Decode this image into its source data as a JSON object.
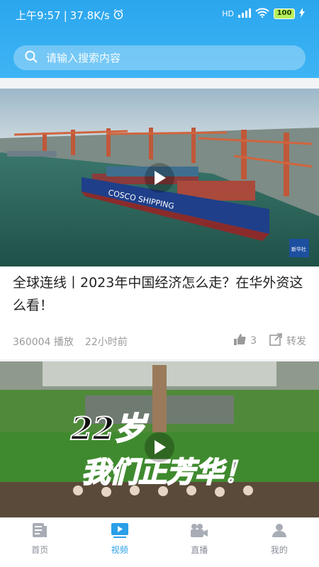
{
  "status_bar": {
    "time": "上午9:57",
    "speed": "37.8K/s",
    "network": "HD",
    "battery": "100"
  },
  "search": {
    "placeholder": "请输入搜索内容"
  },
  "feed": {
    "items": [
      {
        "title": "全球连线丨2023年中国经济怎么走？在华外资这么看！",
        "plays": "360004 播放",
        "time": "22小时前",
        "likes": "3",
        "share_label": "转发",
        "ship_text": "COSCO SHIPPING",
        "watermark": "新华社"
      },
      {
        "title_overlay_1": "22岁",
        "title_overlay_2": "我们正芳华！"
      }
    ]
  },
  "tabbar": {
    "items": [
      {
        "label": "首页",
        "icon": "news-icon"
      },
      {
        "label": "视频",
        "icon": "video-icon",
        "active": true
      },
      {
        "label": "直播",
        "icon": "camera-icon"
      },
      {
        "label": "我的",
        "icon": "user-icon"
      }
    ]
  },
  "colors": {
    "header": "#3fb4f4",
    "accent": "#2a9fe8"
  }
}
